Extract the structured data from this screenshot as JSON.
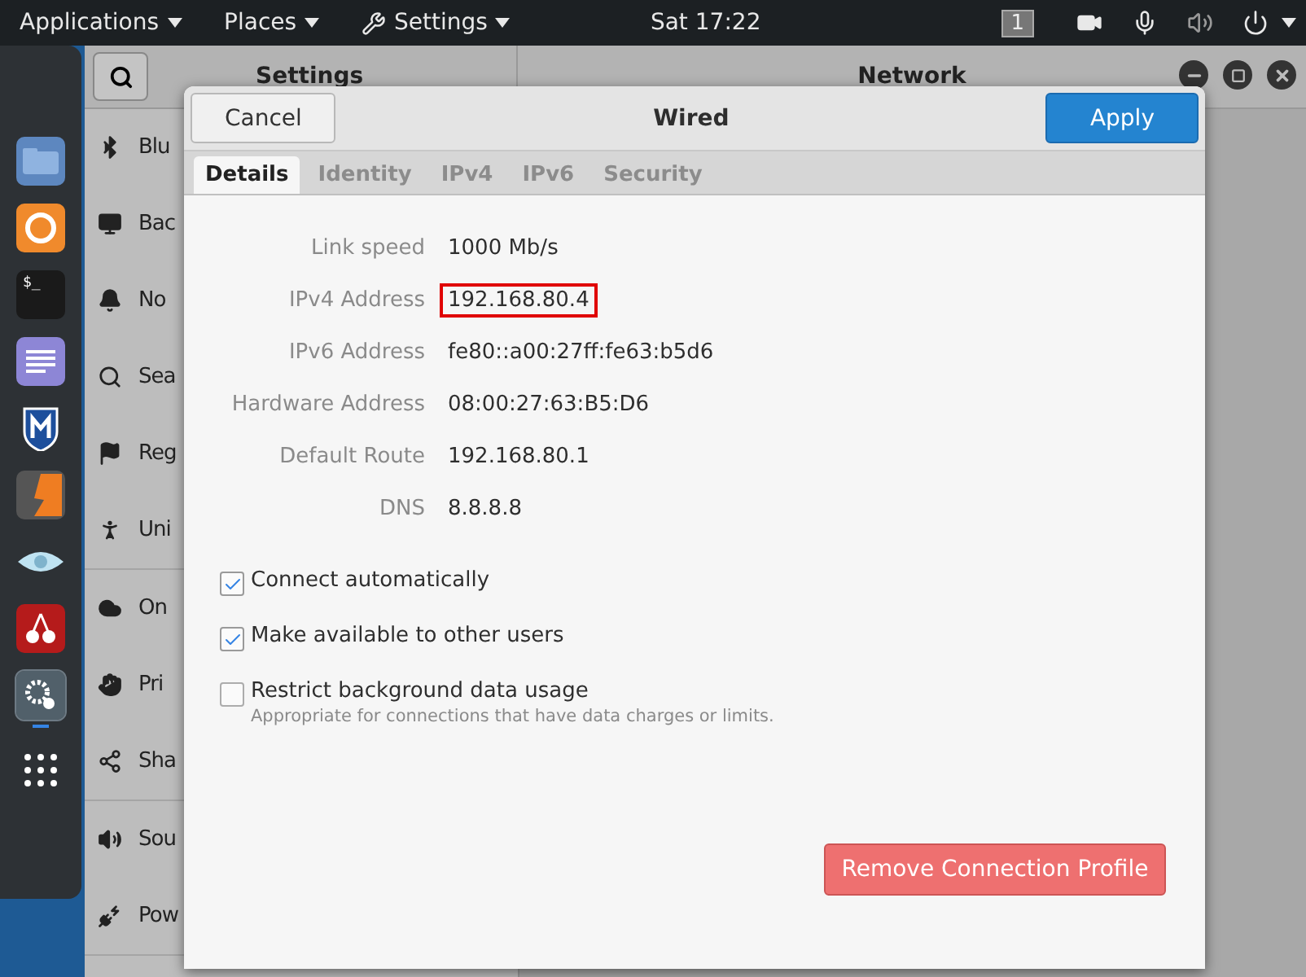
{
  "top_bar": {
    "menus": [
      {
        "label": "Applications"
      },
      {
        "label": "Places"
      },
      {
        "label": "Settings"
      }
    ],
    "clock": "Sat 17:22",
    "workspace": "1"
  },
  "dock": {
    "items": [
      {
        "kind": "folder",
        "selected": false
      },
      {
        "kind": "browser",
        "selected": false
      },
      {
        "kind": "terminal",
        "selected": false,
        "glyph": "$_"
      },
      {
        "kind": "editor",
        "selected": false
      },
      {
        "kind": "shield",
        "selected": false
      },
      {
        "kind": "bolt",
        "selected": false
      },
      {
        "kind": "eye",
        "selected": false
      },
      {
        "kind": "cherry",
        "selected": false
      },
      {
        "kind": "settings",
        "selected": true
      },
      {
        "kind": "apps",
        "selected": false
      }
    ]
  },
  "settings_window": {
    "title": "Settings",
    "panel_title": "Network",
    "sidebar": {
      "groups": [
        [
          {
            "label": "Blu"
          },
          {
            "label": "Bac"
          },
          {
            "label": "No"
          },
          {
            "label": "Sea"
          },
          {
            "label": "Reg"
          },
          {
            "label": "Uni"
          }
        ],
        [
          {
            "label": "On"
          },
          {
            "label": "Pri"
          },
          {
            "label": "Sha"
          }
        ],
        [
          {
            "label": "Sou"
          },
          {
            "label": "Pow"
          }
        ]
      ]
    }
  },
  "dialog": {
    "title": "Wired",
    "cancel": "Cancel",
    "apply": "Apply",
    "tabs": [
      {
        "label": "Details",
        "selected": true
      },
      {
        "label": "Identity",
        "selected": false
      },
      {
        "label": "IPv4",
        "selected": false
      },
      {
        "label": "IPv6",
        "selected": false
      },
      {
        "label": "Security",
        "selected": false
      }
    ],
    "details": [
      {
        "label": "Link speed",
        "value": "1000 Mb/s",
        "highlighted": false
      },
      {
        "label": "IPv4 Address",
        "value": "192.168.80.4",
        "highlighted": true
      },
      {
        "label": "IPv6 Address",
        "value": "fe80::a00:27ff:fe63:b5d6",
        "highlighted": false
      },
      {
        "label": "Hardware Address",
        "value": "08:00:27:63:B5:D6",
        "highlighted": false
      },
      {
        "label": "Default Route",
        "value": "192.168.80.1",
        "highlighted": false
      },
      {
        "label": "DNS",
        "value": "8.8.8.8",
        "highlighted": false
      }
    ],
    "options": [
      {
        "label": "Connect automatically",
        "checked": true
      },
      {
        "label": "Make available to other users",
        "checked": true
      },
      {
        "label": "Restrict background data usage",
        "hint": "Appropriate for connections that have data charges or limits.",
        "checked": false
      }
    ],
    "remove_button": "Remove Connection Profile"
  }
}
